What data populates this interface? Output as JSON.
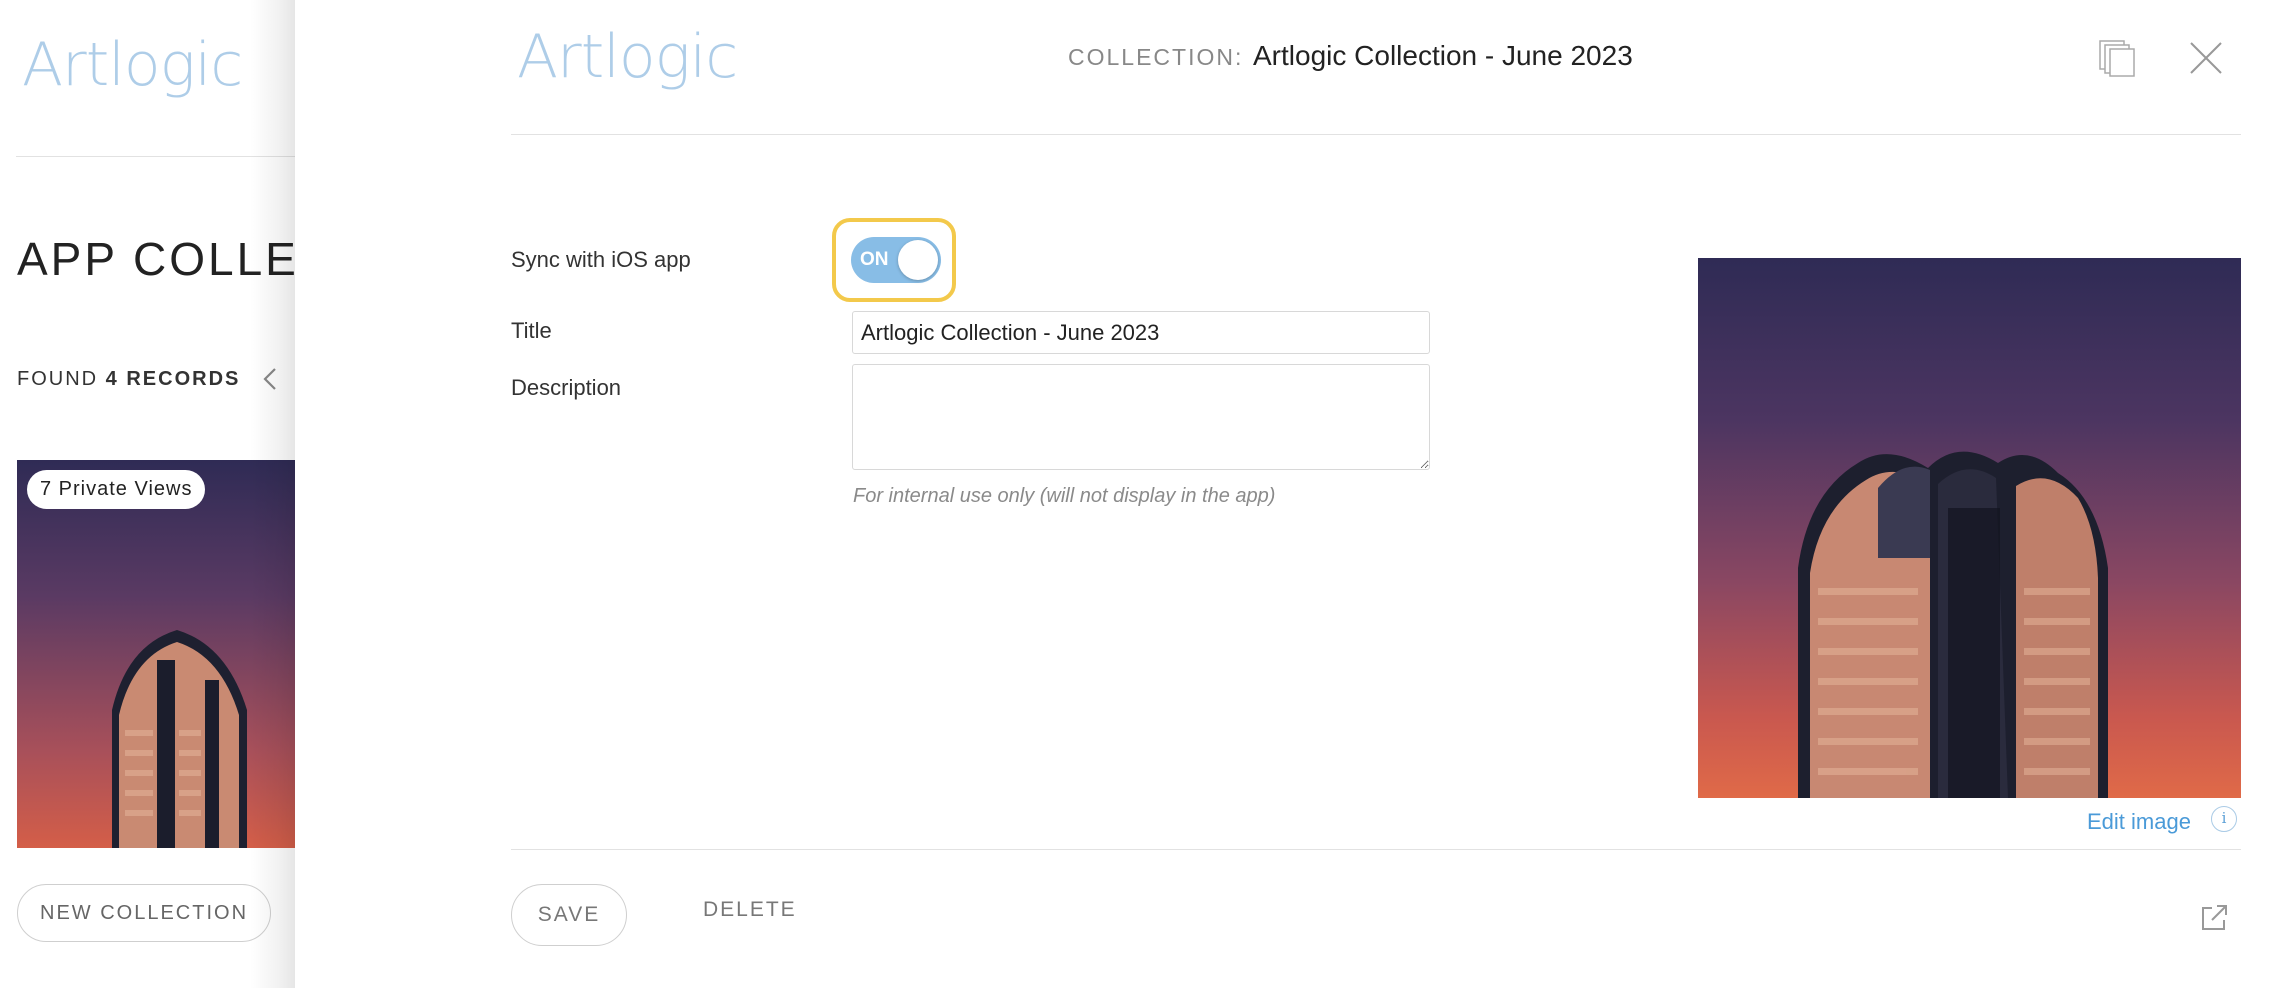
{
  "background_page": {
    "logo": "Artlogic",
    "title": "APP COLLEC",
    "found_prefix": "FOUND ",
    "found_count": "4 RECORDS",
    "card_badge": "7 Private Views",
    "new_collection_label": "NEW COLLECTION"
  },
  "modal": {
    "logo": "Artlogic",
    "collection_label": "COLLECTION:",
    "collection_name": "Artlogic Collection - June 2023",
    "form": {
      "sync_label": "Sync with iOS app",
      "sync_state": "ON",
      "title_label": "Title",
      "title_value": "Artlogic Collection - June 2023",
      "description_label": "Description",
      "description_value": "",
      "description_hint": "For internal use only (will not display in the app)"
    },
    "image": {
      "edit_label": "Edit image",
      "info_glyph": "i"
    },
    "footer": {
      "save_label": "SAVE",
      "delete_label": "DELETE"
    }
  },
  "colors": {
    "logo": "#aecde8",
    "toggle_on": "#88bde6",
    "highlight": "#f3c94b",
    "link": "#4a9ad8"
  },
  "icons": [
    "chevron-left-icon",
    "copy-icon",
    "close-icon",
    "info-icon",
    "external-link-icon"
  ]
}
